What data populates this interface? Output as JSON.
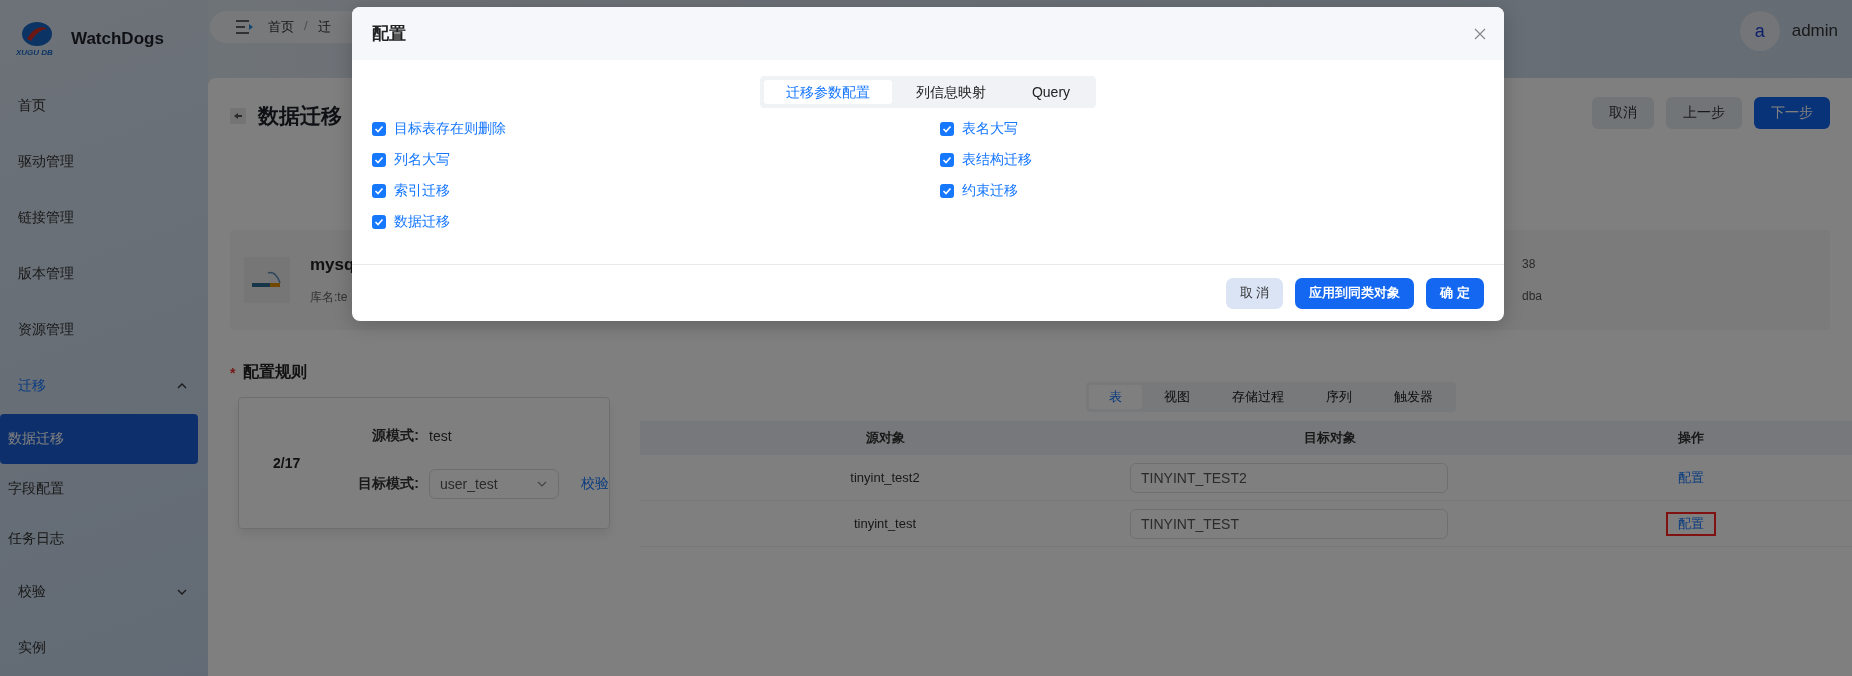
{
  "app": {
    "name": "WatchDogs",
    "logo_caption": "XUGU DB"
  },
  "header": {
    "breadcrumb": [
      {
        "kind": "link",
        "label": "首页"
      },
      {
        "kind": "separator",
        "label": "/"
      },
      {
        "kind": "link",
        "label": "迁"
      }
    ],
    "user": {
      "avatar": "a",
      "name": "admin"
    }
  },
  "sidebar": {
    "items": [
      {
        "label": "首页",
        "selected": false
      },
      {
        "label": "驱动管理",
        "selected": false
      },
      {
        "label": "链接管理",
        "selected": false
      },
      {
        "label": "版本管理",
        "selected": false
      },
      {
        "label": "资源管理",
        "selected": false
      },
      {
        "label": "迁移",
        "selected": false,
        "expanded": true,
        "children": [
          {
            "label": "数据迁移",
            "selected": true
          },
          {
            "label": "字段配置",
            "selected": false
          },
          {
            "label": "任务日志",
            "selected": false
          }
        ]
      },
      {
        "label": "校验",
        "selected": false,
        "expanded": false
      },
      {
        "label": "实例",
        "selected": false
      }
    ]
  },
  "page": {
    "title": "数据迁移",
    "buttons": [
      {
        "label": "取消",
        "kind": "secondary"
      },
      {
        "label": "上一步",
        "kind": "secondary"
      },
      {
        "label": "下一步",
        "kind": "primary"
      }
    ]
  },
  "source_panel": {
    "name": "mysq",
    "database": "库名:te",
    "detail_1": "38",
    "detail_2": "dba"
  },
  "rules": {
    "title": "配置规则",
    "required_mark": "*",
    "counter": "2/17",
    "source_label": "源模式:",
    "source_value": "test",
    "target_label": "目标模式:",
    "target_value": "user_test",
    "check_link": "校验"
  },
  "object_tabs": [
    {
      "label": "表",
      "selected": true
    },
    {
      "label": "视图",
      "selected": false
    },
    {
      "label": "存储过程",
      "selected": false
    },
    {
      "label": "序列",
      "selected": false
    },
    {
      "label": "触发器",
      "selected": false
    }
  ],
  "table": {
    "columns": [
      "源对象",
      "目标对象",
      "操作"
    ],
    "rows": [
      {
        "source": "tinyint_test2",
        "target": "TINYINT_TEST2",
        "action": "配置",
        "highlighted": false
      },
      {
        "source": "tinyint_test",
        "target": "TINYINT_TEST",
        "action": "配置",
        "highlighted": true
      }
    ]
  },
  "dialog": {
    "title": "配置",
    "tabs": [
      {
        "label": "迁移参数配置",
        "selected": true
      },
      {
        "label": "列信息映射",
        "selected": false
      },
      {
        "label": "Query",
        "selected": false
      }
    ],
    "options": [
      {
        "label": "目标表存在则删除",
        "checked": true
      },
      {
        "label": "表名大写",
        "checked": true
      },
      {
        "label": "列名大写",
        "checked": true
      },
      {
        "label": "表结构迁移",
        "checked": true
      },
      {
        "label": "索引迁移",
        "checked": true
      },
      {
        "label": "约束迁移",
        "checked": true
      },
      {
        "label": "数据迁移",
        "checked": true
      }
    ],
    "buttons": [
      {
        "label": "取 消",
        "kind": "secondary"
      },
      {
        "label": "应用到同类对象",
        "kind": "primary"
      },
      {
        "label": "确 定",
        "kind": "primary"
      }
    ]
  }
}
